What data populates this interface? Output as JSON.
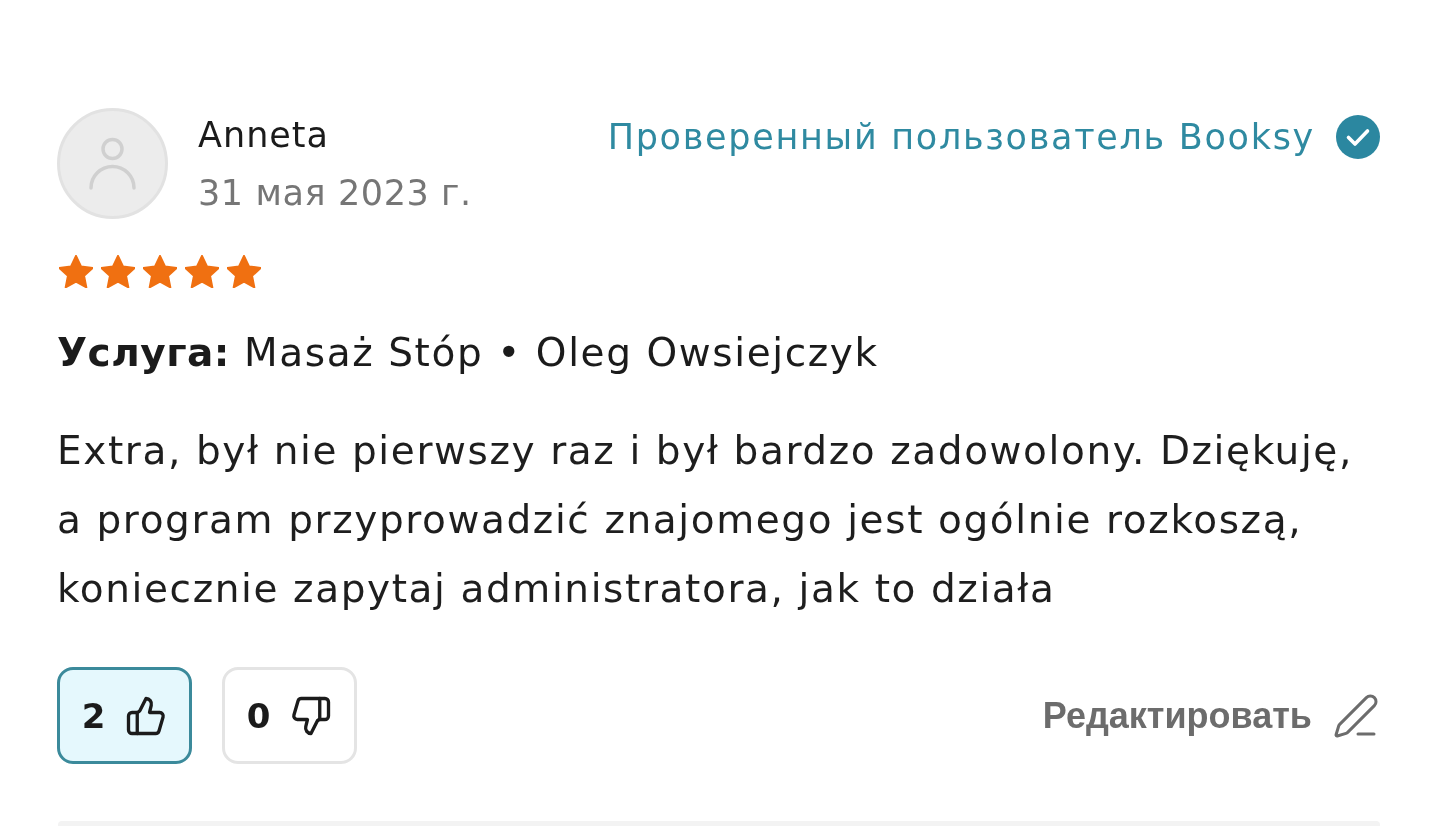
{
  "review": {
    "author": {
      "name": "Anneta",
      "date": "31 мая 2023 г."
    },
    "badge": {
      "label": "Проверенный пользователь Booksy",
      "verified": true
    },
    "stars": 5,
    "service": "**Услуга:** Masaż Stóp • Oleg Owsiejczyk",
    "text": "Extra, był nie pierwszy raz i był bardzo zadowolony. Dziękuję, a program przyprowadzić znajomego jest ogólnie rozkoszą, koniecznie zapytaj administratora, jak to działa",
    "votes": [
      {
        "kind": "like",
        "count": "2",
        "selected": true
      },
      {
        "kind": "dislike",
        "count": "0",
        "selected": false
      }
    ],
    "edit": {
      "label": "Редактировать"
    }
  }
}
